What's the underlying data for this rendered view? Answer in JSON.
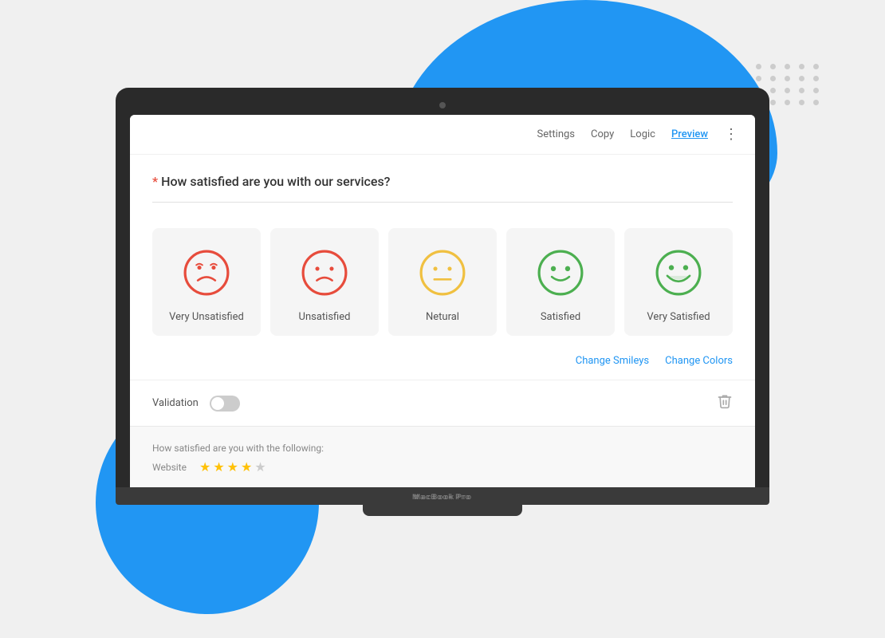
{
  "background": {
    "blobColor": "#2196F3",
    "dotColor": "#cccccc"
  },
  "toolbar": {
    "settings_label": "Settings",
    "copy_label": "Copy",
    "logic_label": "Logic",
    "preview_label": "Preview",
    "more_icon": "⋮"
  },
  "survey": {
    "required_star": "★",
    "question": "How satisfied are you with our services?",
    "options": [
      {
        "id": "very-unsatisfied",
        "label": "Very Unsatisfied",
        "color": "#e74c3c",
        "type": "very-unsatisfied"
      },
      {
        "id": "unsatisfied",
        "label": "Unsatisfied",
        "color": "#e74c3c",
        "type": "unsatisfied"
      },
      {
        "id": "neutral",
        "label": "Netural",
        "color": "#f0c040",
        "type": "neutral"
      },
      {
        "id": "satisfied",
        "label": "Satisfied",
        "color": "#4CAF50",
        "type": "satisfied"
      },
      {
        "id": "very-satisfied",
        "label": "Very Satisfied",
        "color": "#4CAF50",
        "type": "very-satisfied"
      }
    ],
    "change_smileys": "Change Smileys",
    "change_colors": "Change Colors",
    "validation_label": "Validation",
    "trash_icon": "🗑"
  },
  "preview": {
    "question_text": "How satisfied are you with the following:",
    "website_label": "Website",
    "stars": [
      true,
      true,
      true,
      true,
      false
    ]
  },
  "laptop": {
    "brand": "MacBook Pro"
  }
}
